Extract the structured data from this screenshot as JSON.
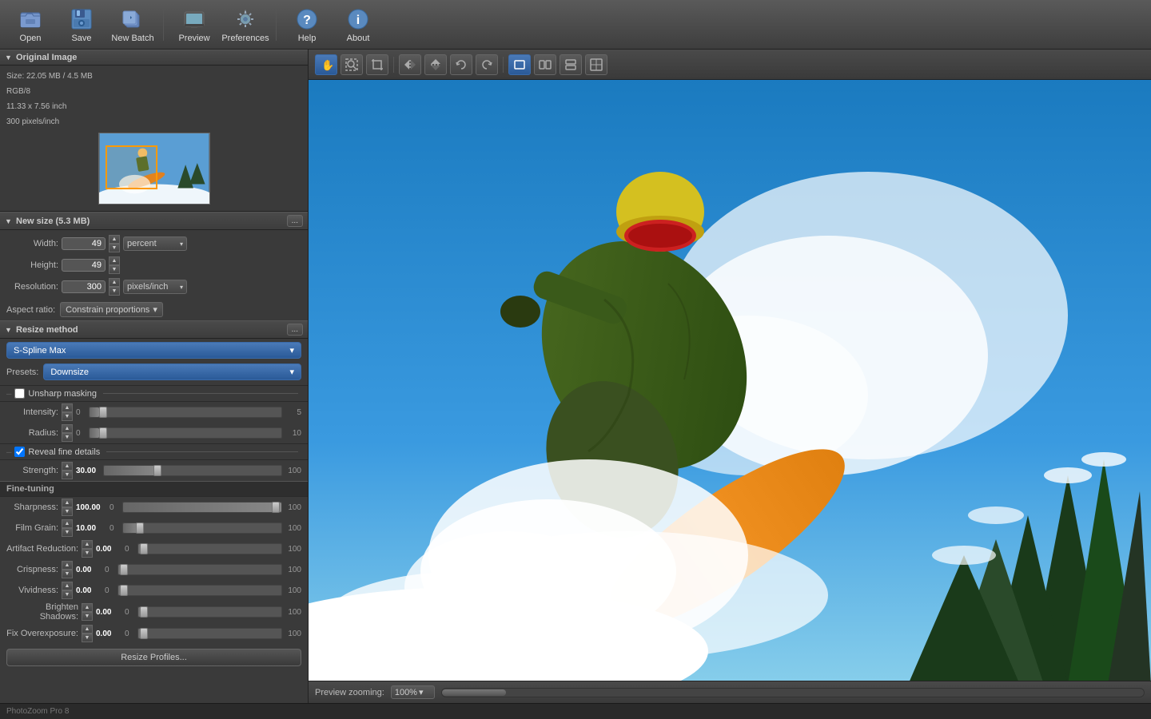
{
  "toolbar": {
    "items": [
      {
        "id": "open",
        "label": "Open",
        "icon": "📂"
      },
      {
        "id": "save",
        "label": "Save",
        "icon": "💾"
      },
      {
        "id": "new-batch",
        "label": "New Batch",
        "icon": "🖼"
      },
      {
        "id": "preview",
        "label": "Preview",
        "icon": "👁"
      },
      {
        "id": "preferences",
        "label": "Preferences",
        "icon": "⚙"
      },
      {
        "id": "help",
        "label": "Help",
        "icon": "❓"
      },
      {
        "id": "about",
        "label": "About",
        "icon": "ℹ"
      }
    ]
  },
  "left_panel": {
    "original_image": {
      "header": "Original Image",
      "size": "Size: 22.05 MB / 4.5 MB",
      "color_mode": "RGB/8",
      "dimensions": "11.33 x 7.56 inch",
      "resolution": "300 pixels/inch"
    },
    "new_size": {
      "header": "New size (5.3 MB)",
      "more_btn": "...",
      "width_label": "Width:",
      "width_value": "49",
      "height_label": "Height:",
      "height_value": "49",
      "unit": "percent",
      "resolution_label": "Resolution:",
      "resolution_value": "300",
      "resolution_unit": "pixels/inch",
      "aspect_ratio_label": "Aspect ratio:",
      "constrain": "Constrain proportions"
    },
    "resize_method": {
      "header": "Resize method",
      "more_btn": "...",
      "method": "S-Spline Max",
      "presets_label": "Presets:",
      "preset": "Downsize"
    },
    "unsharp_masking": {
      "header": "Unsharp masking",
      "enabled": false,
      "intensity_label": "Intensity:",
      "intensity_value": "0",
      "intensity_min": "0",
      "intensity_max": "5",
      "intensity_pct": 0,
      "radius_label": "Radius:",
      "radius_value": "0",
      "radius_min": "0",
      "radius_max": "10",
      "radius_pct": 0
    },
    "reveal_fine_details": {
      "header": "Reveal fine details",
      "enabled": true,
      "strength_label": "Strength:",
      "strength_value": "30.00",
      "strength_min": "0",
      "strength_max": "100",
      "strength_pct": 30
    },
    "fine_tuning": {
      "header": "Fine-tuning",
      "items": [
        {
          "label": "Sharpness:",
          "value": "100.00",
          "min": "0",
          "max": "100",
          "pct": 100
        },
        {
          "label": "Film Grain:",
          "value": "10.00",
          "min": "0",
          "max": "100",
          "pct": 10
        },
        {
          "label": "Artifact Reduction:",
          "value": "0.00",
          "min": "0",
          "max": "100",
          "pct": 0
        },
        {
          "label": "Crispness:",
          "value": "0.00",
          "min": "0",
          "max": "100",
          "pct": 0
        },
        {
          "label": "Vividness:",
          "value": "0.00",
          "min": "0",
          "max": "100",
          "pct": 0
        },
        {
          "label": "Brighten Shadows:",
          "value": "0.00",
          "min": "0",
          "max": "100",
          "pct": 0
        },
        {
          "label": "Fix Overexposure:",
          "value": "0.00",
          "min": "0",
          "max": "100",
          "pct": 0
        }
      ]
    },
    "resize_profiles_btn": "Resize Profiles..."
  },
  "preview_toolbar": {
    "tools": [
      {
        "id": "hand",
        "icon": "✋",
        "active": true
      },
      {
        "id": "zoom-select",
        "icon": "⊞",
        "active": false
      },
      {
        "id": "crop",
        "icon": "✂",
        "active": false
      },
      {
        "id": "flip-h",
        "icon": "↔",
        "active": false
      },
      {
        "id": "flip-v",
        "icon": "↕",
        "active": false
      },
      {
        "id": "rotate-ccw",
        "icon": "↺",
        "active": false
      },
      {
        "id": "rotate-cw",
        "icon": "↻",
        "active": false
      }
    ],
    "view_modes": [
      {
        "id": "single",
        "icon": "▭",
        "active": true
      },
      {
        "id": "split-v",
        "icon": "▭▭",
        "active": false
      },
      {
        "id": "split-h",
        "icon": "▬▬",
        "active": false
      },
      {
        "id": "quad",
        "icon": "⊞",
        "active": false
      }
    ]
  },
  "preview_bottom": {
    "zoom_label": "Preview zooming:",
    "zoom_value": "100%"
  },
  "footer": {
    "app_name": "PhotoZoom Pro 8"
  }
}
